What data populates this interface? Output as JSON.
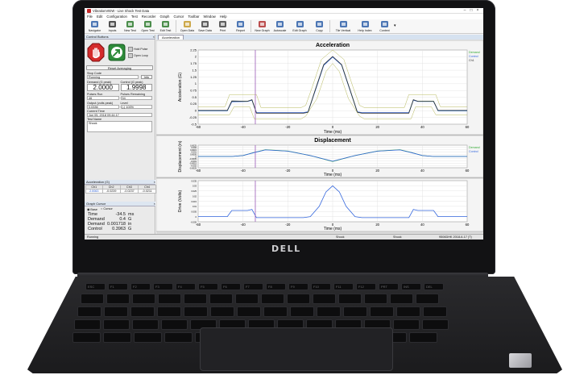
{
  "window": {
    "title": "VibrationVIEW - Live Shock Test Data"
  },
  "menu": [
    "File",
    "Edit",
    "Configuration",
    "Test",
    "Recorder",
    "Graph",
    "Cursor",
    "Toolbar",
    "Window",
    "Help"
  ],
  "toolbar": [
    {
      "label": "Navigator",
      "icon": "navigator-icon",
      "color": "#2e5fa8"
    },
    {
      "label": "Inputs",
      "icon": "inputs-icon",
      "color": "#333333"
    },
    {
      "label": "New Test",
      "icon": "new-test-icon",
      "color": "#2d7a2d"
    },
    {
      "label": "Open Test",
      "icon": "open-test-icon",
      "color": "#2d7a2d"
    },
    {
      "label": "Edit Test",
      "icon": "edit-test-icon",
      "color": "#2d7a2d"
    },
    {
      "label": "Open Data",
      "icon": "open-data-icon",
      "color": "#c49a2c"
    },
    {
      "label": "Save Data",
      "icon": "save-data-icon",
      "color": "#444444"
    },
    {
      "label": "Print",
      "icon": "print-icon",
      "color": "#444444"
    },
    {
      "label": "Report",
      "icon": "report-icon",
      "color": "#2e5fa8"
    },
    {
      "label": "New Graph",
      "icon": "new-graph-icon",
      "color": "#b03030"
    },
    {
      "label": "Autoscale",
      "icon": "autoscale-icon",
      "color": "#2e5fa8"
    },
    {
      "label": "Edit Graph",
      "icon": "edit-graph-icon",
      "color": "#2e5fa8"
    },
    {
      "label": "Copy",
      "icon": "copy-icon",
      "color": "#2e5fa8"
    },
    {
      "label": "Tile Vertical",
      "icon": "tile-vertical-icon",
      "color": "#2e5fa8"
    },
    {
      "label": "Help Index",
      "icon": "help-index-icon",
      "color": "#2e5fa8"
    },
    {
      "label": "Context",
      "icon": "context-help-icon",
      "color": "#2e5fa8"
    }
  ],
  "control_panel": {
    "title": "Control Buttons",
    "hold_pulse": "Hold Pulse",
    "open_loop": "Open Loop",
    "reset_label": "Reset Averaging",
    "stop_code_label": "Stop Code",
    "stop_code_value": "Running",
    "info_label": "Info",
    "demand_label": "Demand (G peak)",
    "demand_value": "2.0000",
    "control_label": "Control (G peak)",
    "control_value": "1.9998",
    "pulses_run_label": "Pulses Run",
    "pulses_run_value": "46",
    "pulses_remaining_label": "Pulses Remaining",
    "pulses_remaining_value": "54",
    "output_label": "Output (volts peak)",
    "output_value": "0.0336",
    "level_label": "Level",
    "level_value": "(-) 100%",
    "current_time_label": "Current Time",
    "current_time_value": "Jun 05, 2018 09:44:17",
    "test_name_label": "Test Name",
    "test_name_value": "Shock"
  },
  "acceleration_panel": {
    "title": "Acceleration (G)",
    "headers": [
      "Ch1",
      "Ch2",
      "Ch3",
      "Ch4"
    ],
    "values": [
      "2.0063",
      "-0.0239",
      "-0.0237",
      "-0.0211"
    ]
  },
  "cursor_panel": {
    "title": "Graph Cursor",
    "base_label": "Base",
    "cursor_label": "Cursor",
    "rows": [
      {
        "k": "Time",
        "v": "-34.5",
        "u": "ms"
      },
      {
        "k": "Demand",
        "v": "0.4",
        "u": "G"
      },
      {
        "k": "Demand",
        "v": "0.001718",
        "u": "in"
      },
      {
        "k": "Control",
        "v": "0.3963",
        "u": "G"
      }
    ]
  },
  "bottom_tabs": [
    "System Check",
    "Shock"
  ],
  "status": {
    "left": "Running",
    "mid1": "Shock",
    "mid2": "Shock",
    "right": "9506DHK  2018-6-17 (T)"
  },
  "doc_tab": "Acceleration",
  "legend": [
    "Demand",
    "Control",
    "Ch1"
  ],
  "colors": {
    "demand": "#33aa33",
    "control": "#3366dd",
    "ch1": "#333333",
    "tolerance": "#b5b85a",
    "cursor": "#9a58b8"
  },
  "chart_data": [
    {
      "type": "line",
      "title": "Acceleration",
      "xlabel": "Time (ms)",
      "ylabel": "Acceleration (G)",
      "xlim": [
        -60,
        60
      ],
      "ylim": [
        -0.5,
        2.25
      ],
      "x_ticks": [
        -60,
        -40,
        -20,
        0,
        20,
        40,
        60
      ],
      "y_ticks": [
        -0.5,
        -0.25,
        0,
        0.25,
        0.5,
        0.75,
        1,
        1.25,
        1.5,
        1.75,
        2,
        2.25
      ],
      "cursor_x": -34.5,
      "series": [
        {
          "name": "Demand",
          "x": [
            -60,
            -47,
            -45,
            -38,
            -36,
            -34,
            -13,
            -11,
            -8,
            -4,
            0,
            4,
            8,
            11,
            13,
            34,
            36,
            38,
            45,
            47,
            60
          ],
          "values": [
            0,
            0,
            0.35,
            0.35,
            0.4,
            -0.08,
            -0.08,
            -0.05,
            0.7,
            1.7,
            2,
            1.7,
            0.7,
            -0.05,
            -0.08,
            -0.08,
            0.4,
            0.35,
            0.35,
            0,
            0
          ]
        },
        {
          "name": "Control",
          "x": [
            -60,
            -47,
            -45,
            -38,
            -36,
            -34,
            -13,
            -11,
            -8,
            -4,
            0,
            4,
            8,
            11,
            13,
            34,
            36,
            38,
            45,
            47,
            60
          ],
          "values": [
            0,
            0,
            0.33,
            0.34,
            0.39,
            -0.07,
            -0.07,
            -0.04,
            0.68,
            1.68,
            1.99,
            1.69,
            0.69,
            -0.04,
            -0.07,
            -0.07,
            0.39,
            0.34,
            0.34,
            0,
            0
          ]
        },
        {
          "name": "Ch1",
          "x": [
            -60,
            -47,
            -45,
            -38,
            -36,
            -34,
            -13,
            -11,
            -8,
            -4,
            0,
            4,
            8,
            11,
            13,
            34,
            36,
            38,
            45,
            47,
            60
          ],
          "values": [
            0.01,
            0.01,
            0.36,
            0.35,
            0.41,
            -0.09,
            -0.09,
            -0.06,
            0.71,
            1.71,
            2.01,
            1.71,
            0.71,
            -0.06,
            -0.09,
            -0.09,
            0.41,
            0.35,
            0.35,
            0.01,
            0.01
          ]
        },
        {
          "name": "Upper tolerance",
          "x": [
            -60,
            -48,
            -46,
            -34,
            -32,
            -14,
            -12,
            -9,
            -5,
            0,
            5,
            9,
            12,
            14,
            32,
            34,
            46,
            48,
            60
          ],
          "values": [
            0.15,
            0.15,
            0.6,
            0.6,
            0.12,
            0.12,
            0.2,
            0.9,
            1.9,
            2.25,
            1.9,
            0.9,
            0.2,
            0.12,
            0.12,
            0.6,
            0.6,
            0.15,
            0.15
          ]
        },
        {
          "name": "Lower tolerance",
          "x": [
            -60,
            -46,
            -44,
            -37,
            -35,
            -14,
            -12,
            -7,
            -3,
            0,
            3,
            7,
            12,
            14,
            35,
            37,
            44,
            46,
            60
          ],
          "values": [
            -0.15,
            -0.15,
            0.15,
            0.15,
            -0.3,
            -0.3,
            -0.2,
            0.45,
            1.45,
            1.75,
            1.45,
            0.45,
            -0.2,
            -0.3,
            -0.3,
            0.15,
            0.15,
            -0.15,
            -0.15
          ]
        }
      ]
    },
    {
      "type": "line",
      "title": "Displacement",
      "xlabel": "Time (ms)",
      "ylabel": "Displacement (in)",
      "xlim": [
        -60,
        60
      ],
      "ylim": [
        -0.0025,
        0.0025
      ],
      "x_ticks": [
        -60,
        -40,
        -20,
        0,
        20,
        40,
        60
      ],
      "y_ticks": [
        -0.0025,
        -0.002,
        -0.0015,
        -0.001,
        -0.0005,
        0,
        0.0005,
        0.001,
        0.0015,
        0.002,
        0.0025
      ],
      "y_tick_labels": [
        "-0.0025",
        "-0.002",
        "-0.0015",
        "-0.001",
        "-0.0005",
        "0",
        "0.0005",
        "0.001",
        "0.0015",
        "0.002",
        "0.0025"
      ],
      "cursor_x": -34.5,
      "series": [
        {
          "name": "Demand",
          "x": [
            -60,
            -45,
            -40,
            -35,
            -30,
            -20,
            -10,
            0,
            10,
            20,
            30,
            35,
            40,
            45,
            60
          ],
          "values": [
            0,
            0,
            0.0002,
            0.0009,
            0.0015,
            0.0012,
            0.0002,
            -0.0011,
            0.0002,
            0.0012,
            0.0015,
            0.0009,
            0.0002,
            0,
            0
          ]
        },
        {
          "name": "Control",
          "x": [
            -60,
            -45,
            -40,
            -35,
            -30,
            -20,
            -10,
            0,
            10,
            20,
            30,
            35,
            40,
            45,
            60
          ],
          "values": [
            0,
            0,
            0.0002,
            0.00085,
            0.00145,
            0.00118,
            0.0002,
            -0.00105,
            0.0002,
            0.00118,
            0.00145,
            0.00085,
            0.0002,
            0,
            0
          ]
        }
      ]
    },
    {
      "type": "line",
      "title": "",
      "xlabel": "Time (ms)",
      "ylabel": "Drive (Volts)",
      "xlim": [
        -60,
        60
      ],
      "ylim": [
        -0.005,
        0.035
      ],
      "x_ticks": [
        -60,
        -40,
        -20,
        0,
        20,
        40,
        60
      ],
      "y_ticks": [
        -0.005,
        0,
        0.005,
        0.01,
        0.015,
        0.02,
        0.025,
        0.03,
        0.035
      ],
      "y_tick_labels": [
        "-0.005",
        "0",
        "0.005",
        "0.01",
        "0.015",
        "0.02",
        "0.025",
        "0.03",
        "0.035"
      ],
      "cursor_x": -34.5,
      "series": [
        {
          "name": "Drive",
          "x": [
            -60,
            -47,
            -45,
            -38,
            -36,
            -34,
            -13,
            -10,
            -6,
            -3,
            0,
            3,
            6,
            10,
            13,
            34,
            36,
            38,
            45,
            47,
            60
          ],
          "values": [
            0,
            0,
            0.006,
            0.006,
            0.007,
            -0.001,
            -0.001,
            0,
            0.01,
            0.024,
            0.03,
            0.024,
            0.01,
            0,
            -0.001,
            -0.001,
            0.007,
            0.006,
            0.006,
            0,
            0
          ]
        }
      ]
    }
  ]
}
